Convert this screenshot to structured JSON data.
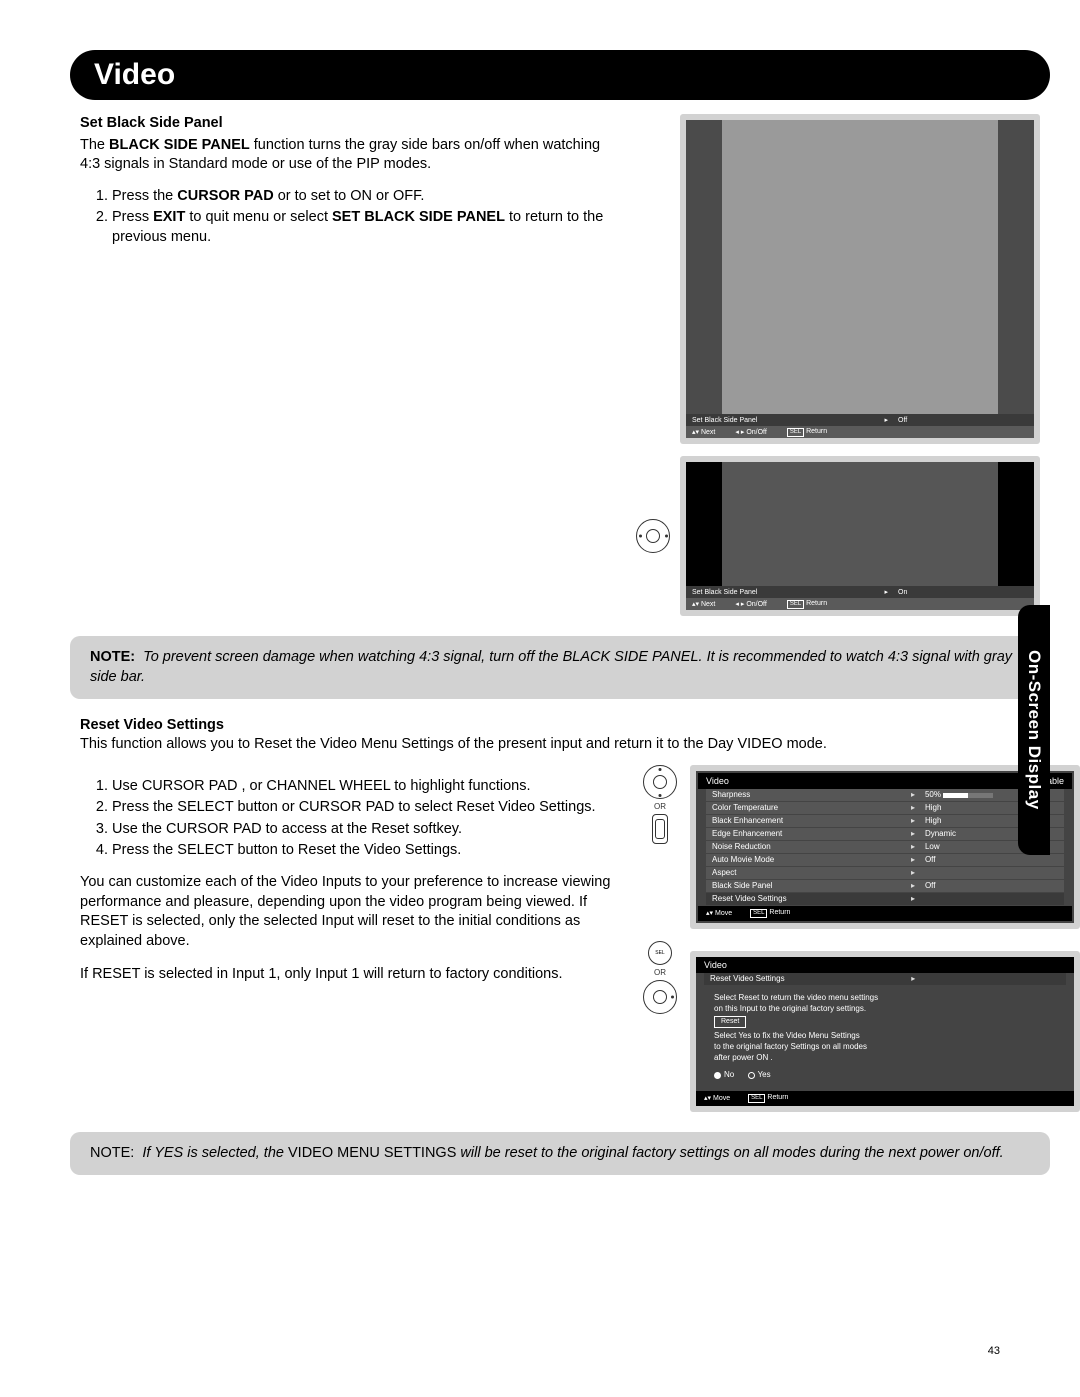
{
  "title": "Video",
  "sideTab": "On-Screen Display",
  "pageNumber": "43",
  "section1": {
    "heading": "Set Black Side Panel",
    "intro_pre": "The ",
    "intro_bold": "BLACK SIDE PANEL",
    "intro_post": " function turns the gray side bars on/off when watching 4:3 signals in Standard mode or use of the PIP modes.",
    "ol1_pre": "Press the ",
    "ol1_bold": "CURSOR PAD",
    "ol1_post": "     or     to set to ON or OFF.",
    "ol2_pre": "Press ",
    "ol2_b1": "EXIT",
    "ol2_mid": " to quit menu or select ",
    "ol2_b2": "SET BLACK SIDE PANEL",
    "ol2_post": " to return to the previous menu."
  },
  "osd1": {
    "label": "Set Black Side Panel",
    "value": "Off",
    "hintNext": "Next",
    "hintOnOff": "On/Off",
    "hintReturn": "Return"
  },
  "osd2": {
    "label": "Set Black Side Panel",
    "value": "On",
    "hintNext": "Next",
    "hintOnOff": "On/Off",
    "hintReturn": "Return"
  },
  "note1": {
    "label": "NOTE:",
    "text": "To prevent screen damage when watching 4:3 signal, turn off the BLACK SIDE PANEL.  It is recommended to watch 4:3 signal with gray side bar."
  },
  "section2": {
    "heading": "Reset Video Settings",
    "intro": "This function allows you to Reset the Video Menu Settings of the present input and return it to the Day VIDEO mode.",
    "ol": [
      "Use CURSOR PAD    ,    or CHANNEL WHEEL to highlight functions.",
      "Press the SELECT button or CURSOR PAD     to select Reset Video Settings.",
      "Use the CURSOR PAD     to access at the Reset softkey.",
      "Press the SELECT button to Reset the Video Settings."
    ],
    "para2": "You can customize each of the Video Inputs to your preference to increase viewing performance and pleasure, depending upon the video program being viewed. If RESET is selected, only the selected Input will reset to the initial conditions as explained above.",
    "para3": "If RESET is selected in Input 1, only Input 1 will return to factory conditions."
  },
  "menu": {
    "title": "Video",
    "source": "Cable",
    "rows": [
      {
        "label": "Sharpness",
        "value": "50%",
        "bar": true
      },
      {
        "label": "Color Temperature",
        "value": "High"
      },
      {
        "label": "Black Enhancement",
        "value": "High"
      },
      {
        "label": "Edge Enhancement",
        "value": "Dynamic"
      },
      {
        "label": "Noise Reduction",
        "value": "Low"
      },
      {
        "label": "Auto Movie Mode",
        "value": "Off"
      },
      {
        "label": "Aspect",
        "value": ""
      },
      {
        "label": "Black Side Panel",
        "value": "Off"
      },
      {
        "label": "Reset Video Settings",
        "value": ""
      }
    ],
    "footMove": "Move",
    "footReturn": "Return"
  },
  "resetDialog": {
    "title": "Video",
    "rowLabel": "Reset Video Settings",
    "line1": "Select  Reset  to return the video menu settings",
    "line2": "on this Input to the original factory settings.",
    "btn": "Reset",
    "line3": "Select  Yes  to fix the Video Menu Settings",
    "line4": "to the original factory Settings on all modes",
    "line5": "after power  ON .",
    "no": "No",
    "yes": "Yes",
    "footMove": "Move",
    "footReturn": "Return"
  },
  "note2": {
    "label": "NOTE:",
    "t1": "If YES is selected, the ",
    "t2": "VIDEO MENU SETTINGS ",
    "t3": "will be reset to the original factory settings on all modes during the next power on/off."
  },
  "orLabel": "OR",
  "selLabel": "SEL"
}
